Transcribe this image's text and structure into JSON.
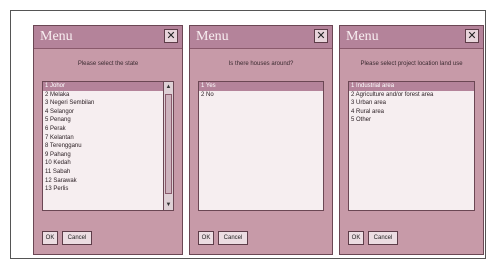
{
  "dialogs": [
    {
      "title": "Menu",
      "prompt": "Please select the state",
      "items": [
        "1 Johor",
        "2 Melaka",
        "3 Negeri Sembilan",
        "4 Selangor",
        "5 Penang",
        "6 Perak",
        "7 Kelantan",
        "8 Terengganu",
        "9 Pahang",
        "10 Kedah",
        "11 Sabah",
        "12 Sarawak",
        "13 Perlis"
      ],
      "ok_label": "OK",
      "cancel_label": "Cancel"
    },
    {
      "title": "Menu",
      "prompt": "Is there houses around?",
      "items": [
        "1 Yes",
        "2 No"
      ],
      "ok_label": "OK",
      "cancel_label": "Cancel"
    },
    {
      "title": "Menu",
      "prompt": "Please select project location land use",
      "items": [
        "1 Industrial area",
        "2 Agriculture and/or forest area",
        "3 Urban area",
        "4 Rural area",
        "5 Other"
      ],
      "ok_label": "OK",
      "cancel_label": "Cancel"
    }
  ],
  "close_glyph": "✕",
  "colors": {
    "window": "#c79aa8",
    "titlebar": "#b4839a",
    "selection": "#b4839a",
    "list_bg": "#f6eef0"
  }
}
